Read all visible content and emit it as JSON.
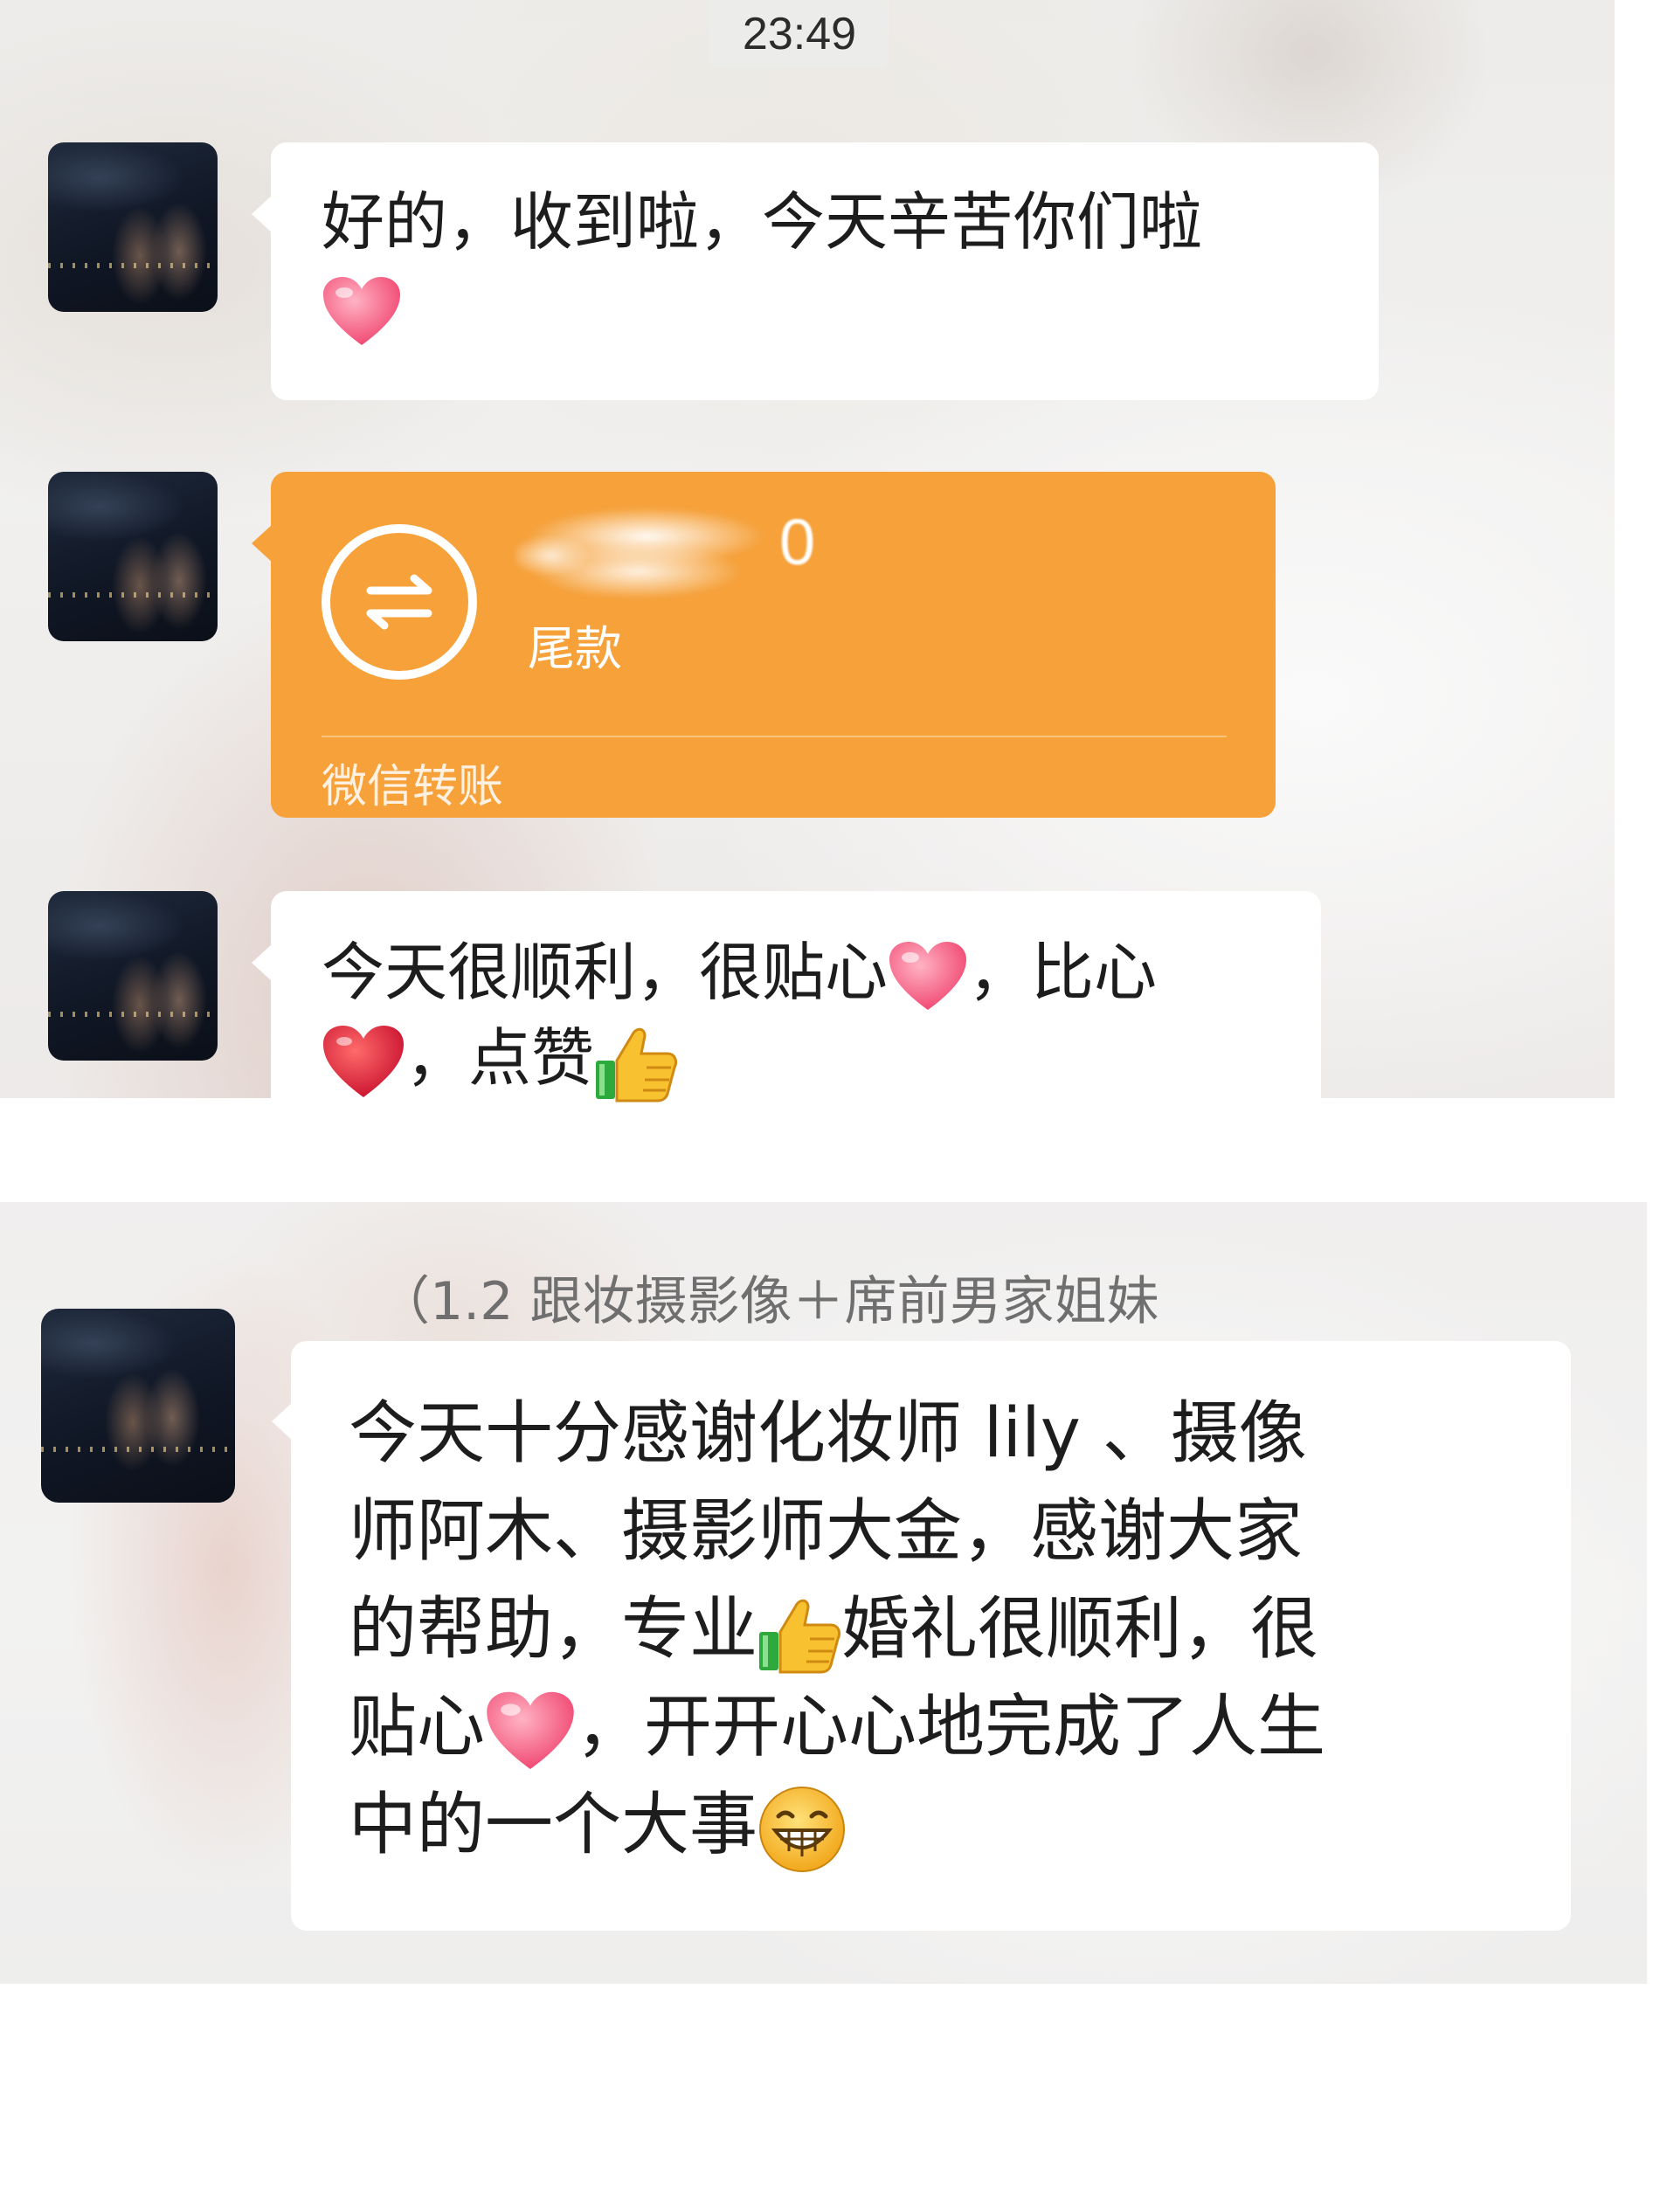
{
  "status_bar": {
    "time": "23:49"
  },
  "messages": [
    {
      "type": "text",
      "text_before": "好的，收到啦，今天辛苦你们啦",
      "emoji": "pink-heart"
    },
    {
      "type": "transfer",
      "note": "尾款",
      "amount_visible": "0",
      "footer": "微信转账",
      "card_color": "#f6a13a"
    },
    {
      "type": "text",
      "part1": "今天很顺利，很贴心",
      "part2": "，比心",
      "part3": "，点赞"
    },
    {
      "type": "text",
      "sender": "（1.2 跟妆摄影像＋席前男家姐妹",
      "line1": "今天十分感谢化妆师 lily 、摄像",
      "line2": "师阿木、摄影师大金，感谢大家",
      "line3a": "的帮助，专业",
      "line3b": "婚礼很顺利，很",
      "line4a": "贴心",
      "line4b": "，开开心心地完成了人生",
      "line5": "中的一个大事"
    }
  ]
}
